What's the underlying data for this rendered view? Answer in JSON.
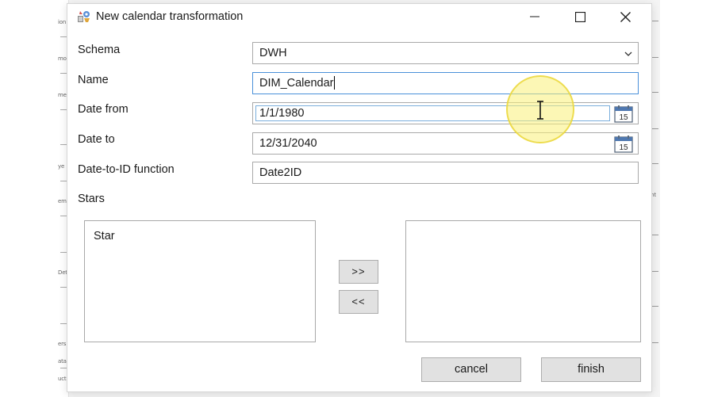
{
  "background": {
    "left_fragments": [
      "ion",
      "mo",
      "me",
      "ye",
      "em",
      "Det",
      "ers",
      "ata",
      "uct"
    ],
    "right_fragment": "nt"
  },
  "dialog": {
    "title": "New calendar transformation",
    "icon": "transformation-app-icon",
    "window_buttons": {
      "minimize_icon": "minimize-icon",
      "maximize_icon": "maximize-icon",
      "close_icon": "close-icon"
    }
  },
  "form": {
    "schema": {
      "label": "Schema",
      "value": "DWH"
    },
    "name": {
      "label": "Name",
      "value": "DIM_Calendar"
    },
    "date_from": {
      "label": "Date from",
      "value": "1/1/1980",
      "calendar_icon_text": "15"
    },
    "date_to": {
      "label": "Date to",
      "value": "12/31/2040",
      "calendar_icon_text": "15"
    },
    "date_to_id_function": {
      "label": "Date-to-ID function",
      "value": "Date2ID"
    },
    "stars": {
      "label": "Stars",
      "available": [
        "Star"
      ],
      "selected": []
    }
  },
  "buttons": {
    "add": ">>",
    "remove": "<<",
    "cancel": "cancel",
    "finish": "finish"
  },
  "colors": {
    "focus_border": "#4a90d9",
    "button_bg": "#e1e1e1",
    "cursor_highlight": "#faf078"
  }
}
